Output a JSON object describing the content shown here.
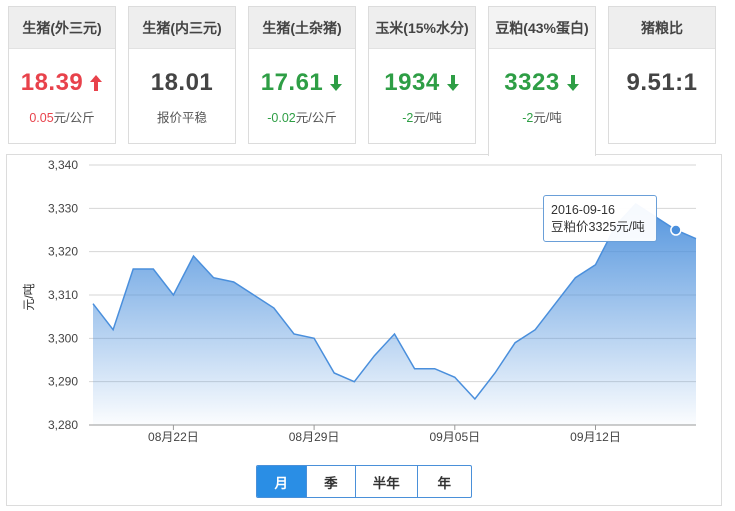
{
  "cards": [
    {
      "title": "生猪(外三元)",
      "price": "18.39",
      "trend": "up",
      "change": "0.05",
      "unit": "元/公斤"
    },
    {
      "title": "生猪(内三元)",
      "price": "18.01",
      "trend": "flat",
      "change": "",
      "unit": "报价平稳"
    },
    {
      "title": "生猪(土杂猪)",
      "price": "17.61",
      "trend": "down",
      "change": "-0.02",
      "unit": "元/公斤"
    },
    {
      "title": "玉米(15%水分)",
      "price": "1934",
      "trend": "down",
      "change": "-2",
      "unit": "元/吨"
    },
    {
      "title": "豆粕(43%蛋白)",
      "price": "3323",
      "trend": "down",
      "change": "-2",
      "unit": "元/吨",
      "active": true
    },
    {
      "title": "猪粮比",
      "price": "9.51:1",
      "trend": "flat",
      "change": "",
      "unit": ""
    }
  ],
  "colors": {
    "up": "#e8424b",
    "down": "#2e9e45",
    "accent": "#2a8ee5",
    "area": "#4a8fdc"
  },
  "chart_data": {
    "type": "area",
    "ylabel": "元/吨",
    "ylim": [
      3280,
      3340
    ],
    "yticks": [
      "3,280",
      "3,290",
      "3,300",
      "3,310",
      "3,320",
      "3,330",
      "3,340"
    ],
    "xlabels": [
      {
        "label": "08月22日",
        "index": 4
      },
      {
        "label": "08月29日",
        "index": 11
      },
      {
        "label": "09月05日",
        "index": 18
      },
      {
        "label": "09月12日",
        "index": 25
      }
    ],
    "dates": [
      "2016-08-18",
      "2016-08-19",
      "2016-08-20",
      "2016-08-21",
      "2016-08-22",
      "2016-08-23",
      "2016-08-24",
      "2016-08-25",
      "2016-08-26",
      "2016-08-27",
      "2016-08-28",
      "2016-08-29",
      "2016-08-30",
      "2016-08-31",
      "2016-09-01",
      "2016-09-02",
      "2016-09-03",
      "2016-09-04",
      "2016-09-05",
      "2016-09-06",
      "2016-09-07",
      "2016-09-08",
      "2016-09-09",
      "2016-09-10",
      "2016-09-11",
      "2016-09-12",
      "2016-09-13",
      "2016-09-14",
      "2016-09-15",
      "2016-09-16",
      "2016-09-17"
    ],
    "values": [
      3308,
      3302,
      3316,
      3316,
      3310,
      3319,
      3314,
      3313,
      3310,
      3307,
      3301,
      3300,
      3292,
      3290,
      3296,
      3301,
      3293,
      3293,
      3291,
      3286,
      3292,
      3299,
      3302,
      3308,
      3314,
      3317,
      3326,
      3331,
      3328,
      3325,
      3323
    ],
    "grid": true,
    "tooltip": {
      "date": "2016-09-16",
      "text": "豆粕价3325元/吨",
      "index": 29
    }
  },
  "periods": {
    "items": [
      "月",
      "季",
      "半年",
      "年"
    ],
    "selected": "月"
  }
}
